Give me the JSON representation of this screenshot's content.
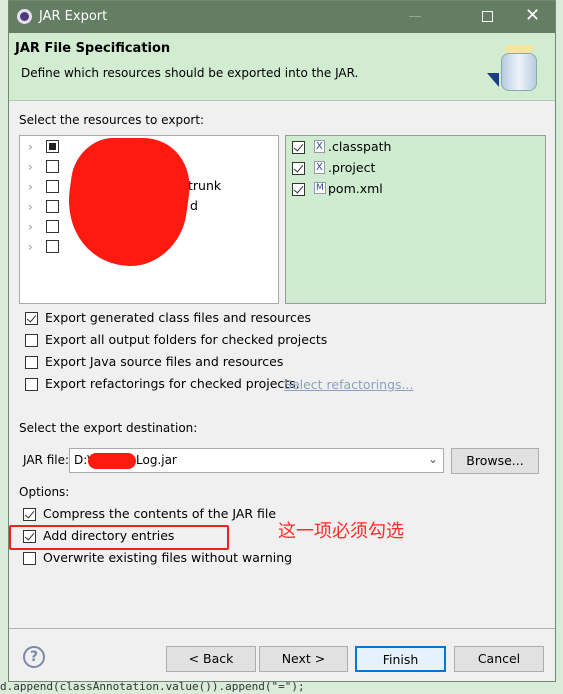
{
  "window": {
    "title": "JAR Export",
    "controls": [
      "minimize",
      "maximize",
      "close"
    ]
  },
  "header": {
    "title": "JAR File Specification",
    "description": "Define which resources should be exported into the JAR."
  },
  "resources": {
    "label": "Select the resources to export:",
    "tree_items": [
      {
        "checked": "partial",
        "label": ""
      },
      {
        "checked": false,
        "label": ""
      },
      {
        "checked": false,
        "label": "trunk"
      },
      {
        "checked": false,
        "label": "d"
      },
      {
        "checked": false,
        "label": ""
      },
      {
        "checked": false,
        "label": ""
      }
    ],
    "files": [
      {
        "checked": true,
        "icon": "xml-file-icon",
        "label": ".classpath"
      },
      {
        "checked": true,
        "icon": "xml-file-icon",
        "label": ".project"
      },
      {
        "checked": true,
        "icon": "maven-pom-icon",
        "label": "pom.xml"
      }
    ]
  },
  "export_options": [
    {
      "checked": true,
      "label": "Export generated class files and resources"
    },
    {
      "checked": false,
      "label": "Export all output folders for checked projects"
    },
    {
      "checked": false,
      "label": "Export Java source files and resources"
    },
    {
      "checked": false,
      "label": "Export refactorings for checked projects."
    }
  ],
  "select_refactorings_link": "Select refactorings...",
  "destination": {
    "label": "Select the export destination:",
    "jar_label": "JAR file:",
    "jar_prefix": "D:\\",
    "jar_suffix": "Log.jar",
    "browse": "Browse..."
  },
  "options": {
    "label": "Options:",
    "items": [
      {
        "checked": true,
        "label": "Compress the contents of the JAR file"
      },
      {
        "checked": true,
        "label": "Add directory entries"
      },
      {
        "checked": false,
        "label": "Overwrite existing files without warning"
      }
    ]
  },
  "annotation": "这一项必须勾选",
  "buttons": {
    "back": "< Back",
    "next": "Next >",
    "finish": "Finish",
    "cancel": "Cancel"
  },
  "background_code": "d.append(classAnnotation.value()).append(\"=\");",
  "colors": {
    "titlebar": "#637e63",
    "header": "#d2ecd2",
    "annotation": "#ff2020",
    "finish_border": "#0078d7"
  }
}
